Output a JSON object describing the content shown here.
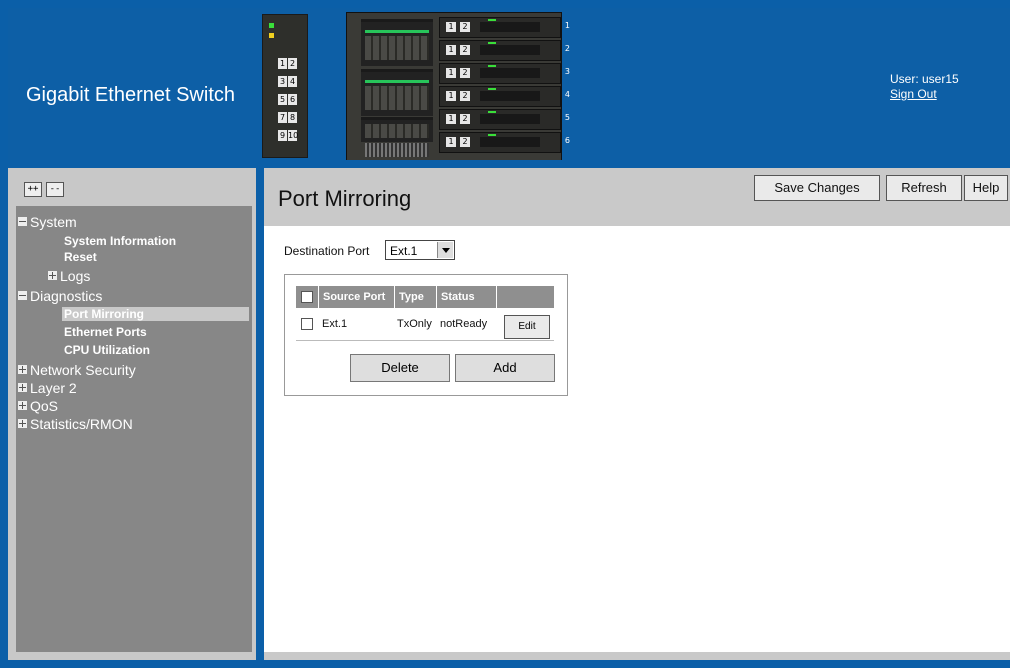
{
  "header": {
    "title": "Gigabit Ethernet Switch",
    "user_label": "User: user15",
    "signout_label": "Sign Out",
    "small_device_ports": [
      "1",
      "2",
      "3",
      "4",
      "5",
      "6",
      "7",
      "8",
      "9",
      "10"
    ],
    "module_ports": [
      "1",
      "2"
    ],
    "module_numbers": [
      "1",
      "2",
      "3",
      "4",
      "5",
      "6"
    ]
  },
  "sidebar": {
    "expand_label": "++",
    "collapse_label": "--",
    "tree": {
      "system": "System",
      "system_information": "System Information",
      "reset": "Reset",
      "logs": "Logs",
      "diagnostics": "Diagnostics",
      "port_mirroring": "Port Mirroring",
      "ethernet_ports": "Ethernet Ports",
      "cpu_utilization": "CPU Utilization",
      "network_security": "Network Security",
      "layer2": "Layer 2",
      "qos": "QoS",
      "statistics": "Statistics/RMON"
    }
  },
  "main": {
    "title": "Port Mirroring",
    "buttons": {
      "save": "Save Changes",
      "refresh": "Refresh",
      "help": "Help"
    },
    "destination_label": "Destination Port",
    "destination_value": "Ext.1",
    "table": {
      "headers": {
        "source_port": "Source Port",
        "type": "Type",
        "status": "Status"
      },
      "rows": [
        {
          "source_port": "Ext.1",
          "type": "TxOnly",
          "status": "notReady",
          "edit_label": "Edit"
        }
      ]
    },
    "delete_label": "Delete",
    "add_label": "Add"
  },
  "colors": {
    "frame_blue": "#0b5fa8",
    "sidebar_gray": "#878787",
    "header_gray": "#c9c9c9"
  }
}
